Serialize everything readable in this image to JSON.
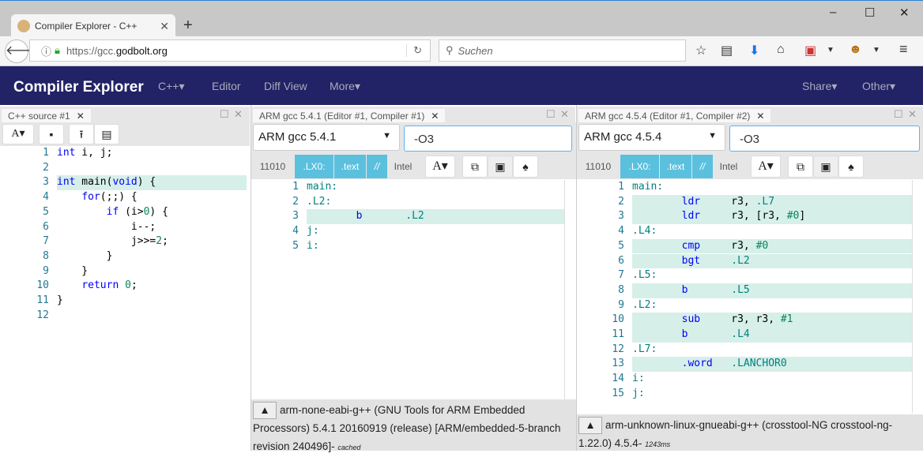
{
  "browser": {
    "tab_title": "Compiler Explorer - C++",
    "url_prefix": "https://gcc.",
    "url_domain": "godbolt.org",
    "search_placeholder": "Suchen"
  },
  "app": {
    "brand": "Compiler Explorer",
    "menu": [
      "C++▾",
      "Editor",
      "Diff View",
      "More▾"
    ],
    "right_menu": [
      "Share▾",
      "Other▾"
    ],
    "nav_bg": "#222266"
  },
  "source": {
    "tab": "C++ source #1",
    "font_btn": "A▾",
    "lines": [
      [
        [
          "kw",
          "int"
        ],
        [
          "pl",
          " i, j;"
        ]
      ],
      [],
      [
        [
          "kw",
          "int"
        ],
        [
          "pl",
          " main("
        ],
        [
          "kw",
          "void"
        ],
        [
          "pl",
          ") {"
        ]
      ],
      [
        [
          "pl",
          "    "
        ],
        [
          "kw",
          "for"
        ],
        [
          "pl",
          "(;;) {"
        ]
      ],
      [
        [
          "pl",
          "        "
        ],
        [
          "kw",
          "if"
        ],
        [
          "pl",
          " (i>"
        ],
        [
          "n",
          "0"
        ],
        [
          "pl",
          ") {"
        ]
      ],
      [
        [
          "pl",
          "            i--;"
        ]
      ],
      [
        [
          "pl",
          "            j>>="
        ],
        [
          "n",
          "2"
        ],
        [
          "pl",
          ";"
        ]
      ],
      [
        [
          "pl",
          "        }"
        ]
      ],
      [
        [
          "pl",
          "    }"
        ]
      ],
      [
        [
          "pl",
          "    "
        ],
        [
          "kw",
          "return"
        ],
        [
          "pl",
          " "
        ],
        [
          "n",
          "0"
        ],
        [
          "pl",
          ";"
        ]
      ],
      [
        [
          "pl",
          "}"
        ]
      ],
      []
    ],
    "highlight": [
      3
    ]
  },
  "compilers": [
    {
      "tab": "ARM gcc 5.4.1 (Editor #1, Compiler #1)",
      "compiler": "ARM gcc 5.4.1",
      "options": "-O3",
      "filters": [
        "11010",
        ".LX0:",
        ".text",
        "//",
        "Intel"
      ],
      "font_btn": "A▾",
      "lines": [
        [
          [
            "lab",
            "main:"
          ]
        ],
        [
          [
            "lab",
            ".L2:"
          ]
        ],
        [
          [
            "pl",
            "        "
          ],
          [
            "op",
            "b"
          ],
          [
            "pl",
            "       "
          ],
          [
            "lab",
            ".L2"
          ]
        ],
        [
          [
            "lab",
            "j:"
          ]
        ],
        [
          [
            "lab",
            "i:"
          ]
        ]
      ],
      "highlight": [
        3
      ],
      "status": "arm-none-eabi-g++ (GNU Tools for ARM Embedded Processors) 5.4.1 20160919 (release) [ARM/embedded-5-branch revision 240496]",
      "status_suffix": "- ",
      "timing": "cached"
    },
    {
      "tab": "ARM gcc 4.5.4 (Editor #1, Compiler #2)",
      "compiler": "ARM gcc 4.5.4",
      "options": "-O3",
      "filters": [
        "11010",
        ".LX0:",
        ".text",
        "//",
        "Intel"
      ],
      "font_btn": "A▾",
      "lines": [
        [
          [
            "lab",
            "main:"
          ]
        ],
        [
          [
            "pl",
            "        "
          ],
          [
            "op",
            "ldr"
          ],
          [
            "pl",
            "     r3, "
          ],
          [
            "lab",
            ".L7"
          ]
        ],
        [
          [
            "pl",
            "        "
          ],
          [
            "op",
            "ldr"
          ],
          [
            "pl",
            "     r3, [r3, "
          ],
          [
            "n",
            "#0"
          ],
          [
            "pl",
            "]"
          ]
        ],
        [
          [
            "lab",
            ".L4:"
          ]
        ],
        [
          [
            "pl",
            "        "
          ],
          [
            "op",
            "cmp"
          ],
          [
            "pl",
            "     r3, "
          ],
          [
            "n",
            "#0"
          ]
        ],
        [
          [
            "pl",
            "        "
          ],
          [
            "op",
            "bgt"
          ],
          [
            "pl",
            "     "
          ],
          [
            "lab",
            ".L2"
          ]
        ],
        [
          [
            "lab",
            ".L5:"
          ]
        ],
        [
          [
            "pl",
            "        "
          ],
          [
            "op",
            "b"
          ],
          [
            "pl",
            "       "
          ],
          [
            "lab",
            ".L5"
          ]
        ],
        [
          [
            "lab",
            ".L2:"
          ]
        ],
        [
          [
            "pl",
            "        "
          ],
          [
            "op",
            "sub"
          ],
          [
            "pl",
            "     r3, r3, "
          ],
          [
            "n",
            "#1"
          ]
        ],
        [
          [
            "pl",
            "        "
          ],
          [
            "op",
            "b"
          ],
          [
            "pl",
            "       "
          ],
          [
            "lab",
            ".L4"
          ]
        ],
        [
          [
            "lab",
            ".L7:"
          ]
        ],
        [
          [
            "pl",
            "        "
          ],
          [
            "op",
            ".word"
          ],
          [
            "pl",
            "   "
          ],
          [
            "lab",
            ".LANCHOR0"
          ]
        ],
        [
          [
            "lab",
            "i:"
          ]
        ],
        [
          [
            "lab",
            "j:"
          ]
        ]
      ],
      "highlight": [
        2,
        3,
        5,
        6,
        8,
        10,
        11,
        13
      ],
      "status": "arm-unknown-linux-gnueabi-g++ (crosstool-NG crosstool-ng-1.22.0) 4.5.4",
      "status_suffix": "- ",
      "timing": "1243ms"
    }
  ]
}
